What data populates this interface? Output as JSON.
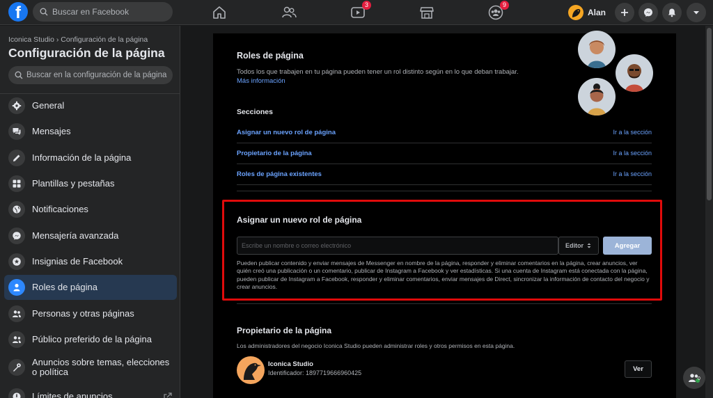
{
  "topbar": {
    "logo": "f",
    "search_placeholder": "Buscar en Facebook",
    "watch_badge": "3",
    "groups_badge": "9",
    "profile_name": "Alan"
  },
  "sidebar": {
    "breadcrumb": "Iconica Studio › Configuración de la página",
    "title": "Configuración de la página",
    "search_placeholder": "Buscar en la configuración de la página",
    "items": [
      {
        "label": "General",
        "icon": "gear-icon"
      },
      {
        "label": "Mensajes",
        "icon": "chat-icon"
      },
      {
        "label": "Información de la página",
        "icon": "pencil-icon"
      },
      {
        "label": "Plantillas y pestañas",
        "icon": "grid-icon"
      },
      {
        "label": "Notificaciones",
        "icon": "globe-icon"
      },
      {
        "label": "Mensajería avanzada",
        "icon": "messenger-icon"
      },
      {
        "label": "Insignias de Facebook",
        "icon": "star-icon"
      },
      {
        "label": "Roles de página",
        "icon": "person-icon"
      },
      {
        "label": "Personas y otras páginas",
        "icon": "people-icon"
      },
      {
        "label": "Público preferido de la página",
        "icon": "audience-icon"
      },
      {
        "label": "Anuncios sobre temas, elecciones o política",
        "icon": "wrench-icon"
      },
      {
        "label": "Límites de anuncios",
        "icon": "limit-icon"
      }
    ],
    "active_index": 7
  },
  "main": {
    "roles_title": "Roles de página",
    "roles_desc": "Todos los que trabajen en tu página pueden tener un rol distinto según en lo que deban trabajar.",
    "more_info": "Más información",
    "sections_title": "Secciones",
    "sections": [
      {
        "label": "Asignar un nuevo rol de página",
        "action": "Ir a la sección"
      },
      {
        "label": "Propietario de la página",
        "action": "Ir a la sección"
      },
      {
        "label": "Roles de página existentes",
        "action": "Ir a la sección"
      }
    ],
    "assign_title": "Asignar un nuevo rol de página",
    "assign_placeholder": "Escribe un nombre o correo electrónico",
    "role_select": "Editor",
    "add_button": "Agregar",
    "assign_desc": "Pueden publicar contenido y enviar mensajes de Messenger en nombre de la página, responder y eliminar comentarios en la página, crear anuncios, ver quién creó una publicación o un comentario, publicar de Instagram a Facebook y ver estadísticas. Si una cuenta de Instagram está conectada con la página, pueden publicar de Instagram a Facebook, responder y eliminar comentarios, enviar mensajes de Direct, sincronizar la información de contacto del negocio y crear anuncios.",
    "owner_title": "Propietario de la página",
    "owner_desc": "Los administradores del negocio Iconica Studio pueden administrar roles y otros permisos en esta página.",
    "owner_name": "Iconica Studio",
    "owner_id": "Identificador: 1897719666960425",
    "view_button": "Ver"
  },
  "float": {
    "badge": "0"
  },
  "colors": {
    "accent": "#2d88ff",
    "highlight": "#e00b0b",
    "link": "#6ba3ff",
    "badge": "#e41e3f"
  }
}
